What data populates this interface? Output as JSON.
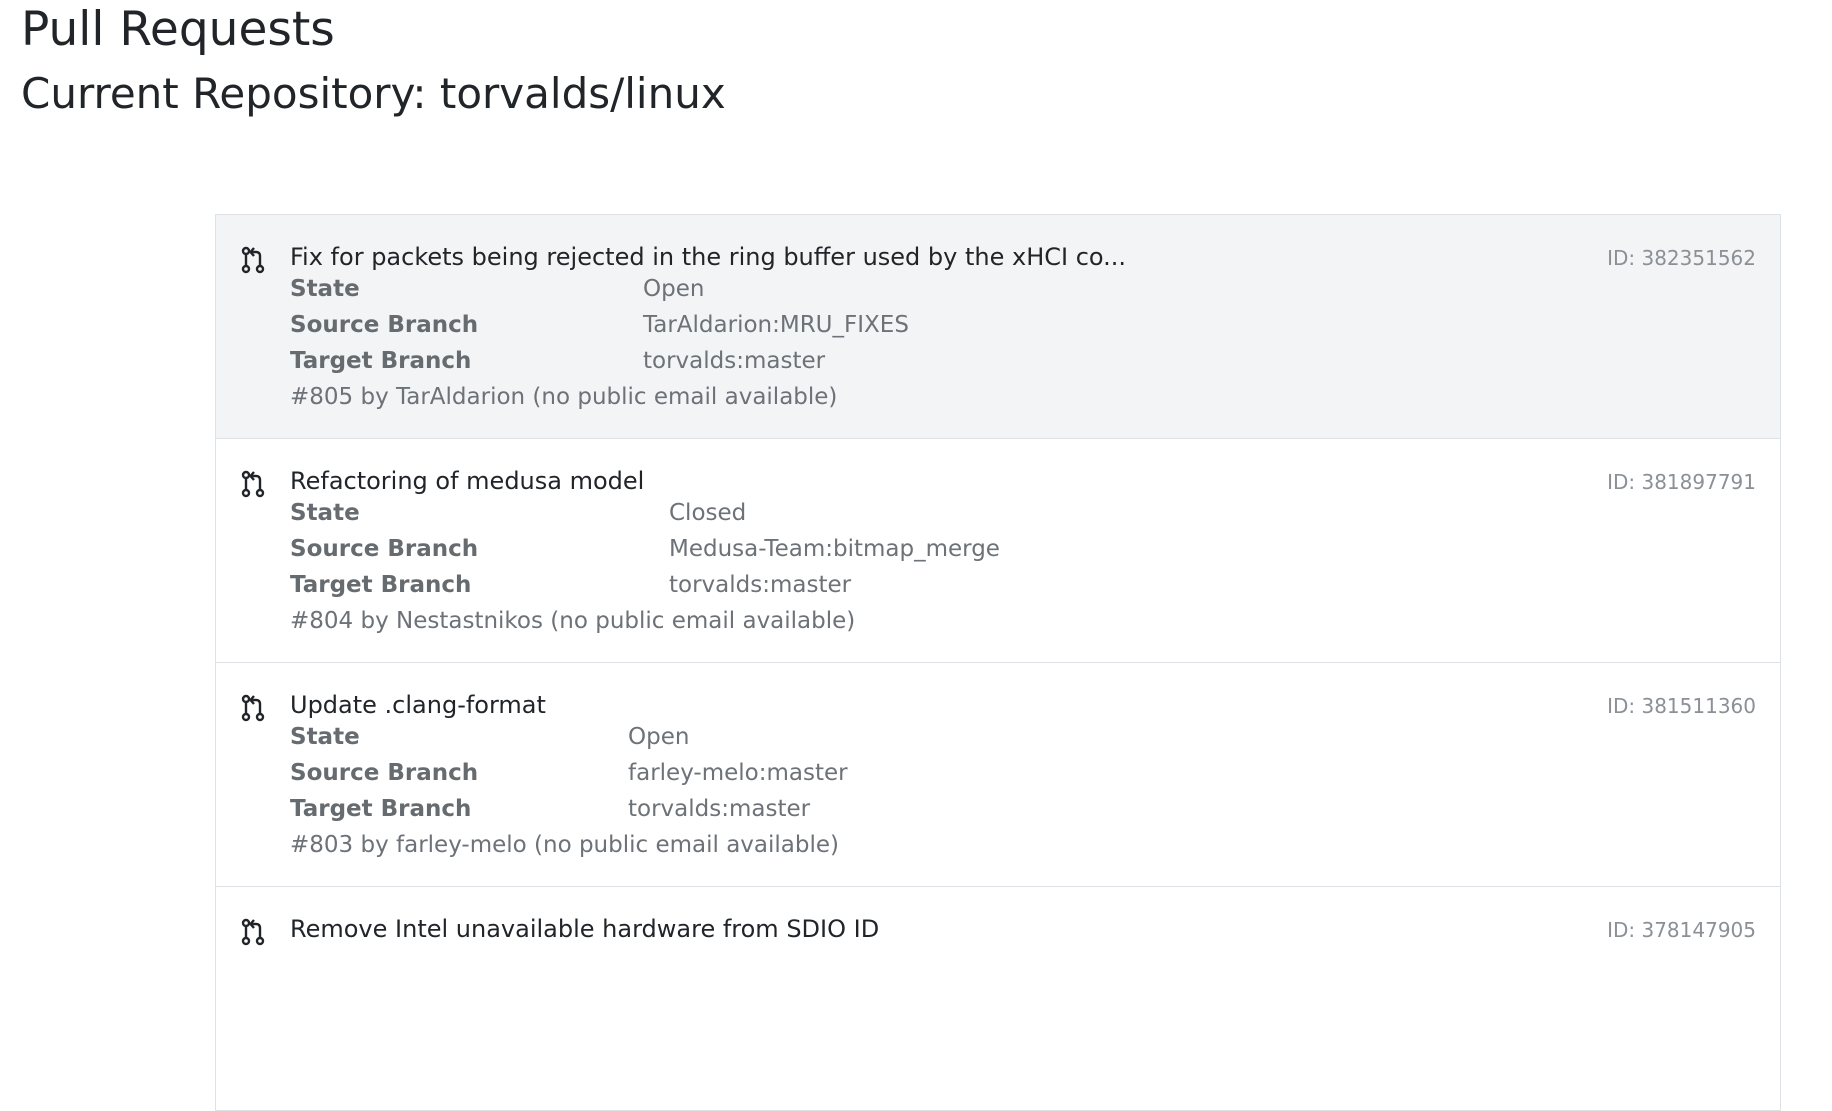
{
  "page": {
    "title": "Pull Requests",
    "subtitle": "Current Repository: torvalds/linux"
  },
  "pull_requests": [
    {
      "title": "Fix for packets being rejected in the ring buffer used by the xHCI co...",
      "id_label": "ID: 382351562",
      "state_label": "State",
      "state": "Open",
      "source_label": "Source Branch",
      "source": "TarAldarion:MRU_FIXES",
      "target_label": "Target Branch",
      "target": "torvalds:master",
      "meta": "#805 by TarAldarion (no public email available)"
    },
    {
      "title": "Refactoring of medusa model",
      "id_label": "ID: 381897791",
      "state_label": "State",
      "state": "Closed",
      "source_label": "Source Branch",
      "source": "Medusa-Team:bitmap_merge",
      "target_label": "Target Branch",
      "target": "torvalds:master",
      "meta": "#804 by Nestastnikos (no public email available)"
    },
    {
      "title": "Update .clang-format",
      "id_label": "ID: 381511360",
      "state_label": "State",
      "state": "Open",
      "source_label": "Source Branch",
      "source": "farley-melo:master",
      "target_label": "Target Branch",
      "target": "torvalds:master",
      "meta": "#803 by farley-melo (no public email available)"
    },
    {
      "title": "Remove Intel unavailable hardware from SDIO ID",
      "id_label": "ID: 378147905",
      "state_label": "",
      "state": "",
      "source_label": "",
      "source": "",
      "target_label": "",
      "target": "",
      "meta": ""
    }
  ],
  "colors": {
    "hover_background": "#f3f4f6",
    "border": "#dee2e6",
    "muted_text": "#6c7278"
  },
  "icons": {
    "pull_request": "git-pull-request-icon"
  }
}
